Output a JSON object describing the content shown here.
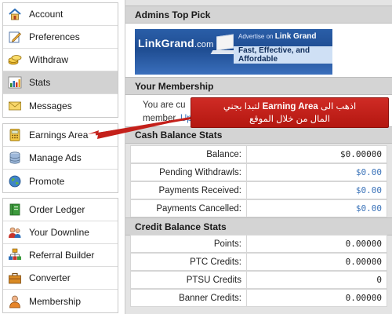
{
  "sidebar": {
    "groups": [
      {
        "items": [
          {
            "label": "Account",
            "icon": "house-icon"
          },
          {
            "label": "Preferences",
            "icon": "pencil-icon"
          },
          {
            "label": "Withdraw",
            "icon": "coins-icon"
          },
          {
            "label": "Stats",
            "icon": "bar-chart-icon",
            "active": true
          },
          {
            "label": "Messages",
            "icon": "envelope-icon"
          }
        ]
      },
      {
        "items": [
          {
            "label": "Earnings Area",
            "icon": "calculator-icon"
          },
          {
            "label": "Manage Ads",
            "icon": "database-icon"
          },
          {
            "label": "Promote",
            "icon": "globe-icon"
          }
        ]
      },
      {
        "items": [
          {
            "label": "Order Ledger",
            "icon": "ledger-icon"
          },
          {
            "label": "Your Downline",
            "icon": "users-icon"
          },
          {
            "label": "Referral Builder",
            "icon": "org-chart-icon"
          },
          {
            "label": "Converter",
            "icon": "toolbox-icon"
          },
          {
            "label": "Membership",
            "icon": "user-icon"
          }
        ]
      }
    ]
  },
  "admins_top_pick": {
    "title": "Admins Top Pick",
    "banner": {
      "logo": "LinkGrand",
      "logo_suffix": ".com",
      "advertise_prefix": "Advertise on",
      "advertise_brand": "Link Grand",
      "tagline": "Fast, Effective, and Affordable"
    }
  },
  "membership": {
    "title": "Your Membership",
    "line1": "You are cu",
    "line2_prefix": "member.",
    "line2_link": "Up"
  },
  "cash_balance": {
    "title": "Cash Balance Stats",
    "rows": [
      {
        "label": "Balance:",
        "value": "$0.00000",
        "link": false
      },
      {
        "label": "Pending Withdrawls:",
        "value": "$0.00",
        "link": true
      },
      {
        "label": "Payments Received:",
        "value": "$0.00",
        "link": true
      },
      {
        "label": "Payments Cancelled:",
        "value": "$0.00",
        "link": true
      }
    ]
  },
  "credit_balance": {
    "title": "Credit Balance Stats",
    "rows": [
      {
        "label": "Points:",
        "value": "0.00000"
      },
      {
        "label": "PTC Credits:",
        "value": "0.00000"
      },
      {
        "label": "PTSU Credits",
        "value": "0"
      },
      {
        "label": "Banner Credits:",
        "value": "0.00000"
      }
    ]
  },
  "callout": {
    "line1_before": "اذهب الى",
    "line1_highlight": "Earning Area",
    "line1_after": "لتبدا بجني",
    "line2": "المال من خلال الموقع",
    "color": "#c4201a"
  }
}
